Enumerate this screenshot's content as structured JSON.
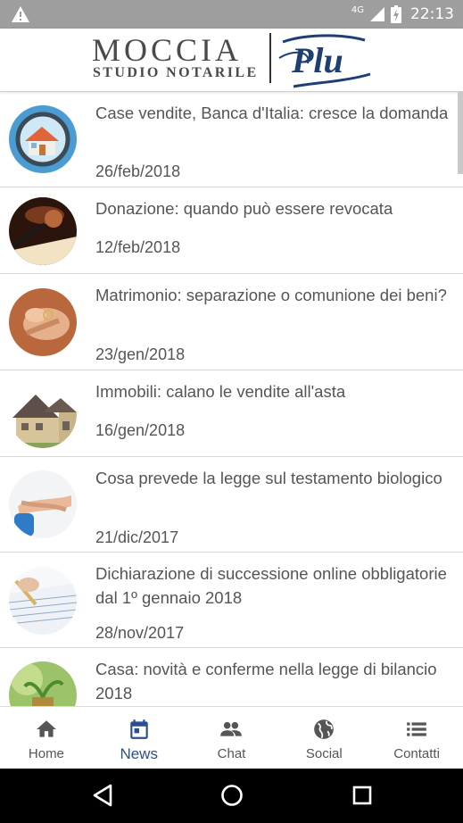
{
  "status_bar": {
    "network": "4G",
    "time": "22:13",
    "icons": [
      "warning-icon",
      "signal-icon",
      "battery-icon"
    ]
  },
  "header": {
    "logo_name": "MOCCIA",
    "logo_subtitle": "STUDIO NOTARILE",
    "logo_mark": "Plu"
  },
  "news": [
    {
      "title": "Case vendite, Banca d'Italia: cresce la domanda",
      "date": "26/feb/2018"
    },
    {
      "title": "Donazione: quando può essere revocata",
      "date": "12/feb/2018"
    },
    {
      "title": "Matrimonio: separazione o comunione dei beni?",
      "date": "23/gen/2018"
    },
    {
      "title": "Immobili: calano le vendite all'asta",
      "date": "16/gen/2018"
    },
    {
      "title": "Cosa prevede la legge sul testamento biologico",
      "date": "21/dic/2017"
    },
    {
      "title": "Dichiarazione di successione online obbligatorie dal 1º gennaio 2018",
      "date": "28/nov/2017"
    },
    {
      "title": "Casa: novità e conferme nella legge di bilancio 2018",
      "date": ""
    }
  ],
  "bottom_nav": {
    "items": [
      {
        "label": "Home",
        "icon": "home-icon",
        "active": false
      },
      {
        "label": "News",
        "icon": "calendar-icon",
        "active": true
      },
      {
        "label": "Chat",
        "icon": "people-icon",
        "active": false
      },
      {
        "label": "Social",
        "icon": "globe-icon",
        "active": false
      },
      {
        "label": "Contatti",
        "icon": "list-icon",
        "active": false
      }
    ]
  },
  "colors": {
    "accent": "#2b4f8c",
    "text": "#555555",
    "icon": "#555555",
    "status_bar": "#9e9e9e"
  }
}
